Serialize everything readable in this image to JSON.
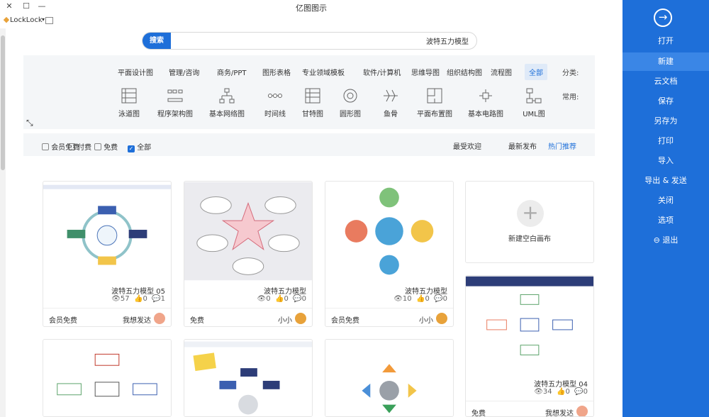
{
  "window": {
    "title": "亿图图示",
    "close": "✕",
    "maximize": "☐",
    "minimize": "—"
  },
  "toolbar": {
    "app_label": "LockLock",
    "flag": "▾"
  },
  "sidebar": {
    "items": [
      {
        "label": "打开"
      },
      {
        "label": "新建"
      },
      {
        "label": "云文档"
      },
      {
        "label": "保存"
      },
      {
        "label": "另存为"
      },
      {
        "label": "打印"
      },
      {
        "label": "导入"
      },
      {
        "label": "导出 & 发送"
      },
      {
        "label": "关闭"
      },
      {
        "label": "选项"
      },
      {
        "label": "退出"
      }
    ]
  },
  "search": {
    "button": "搜索",
    "value": "波特五力模型"
  },
  "categories": {
    "label": "分类:",
    "items": [
      "全部",
      "流程图",
      "组织结构图",
      "思维导图",
      "软件/计算机",
      "专业领域模板",
      "图形表格",
      "商务/PPT",
      "管理/咨询",
      "平面设计图"
    ]
  },
  "tools": {
    "label": "常用:",
    "items": [
      {
        "name": "UML图",
        "icon": "uml-icon"
      },
      {
        "name": "基本电路图",
        "icon": "circuit-icon"
      },
      {
        "name": "平面布置图",
        "icon": "floorplan-icon"
      },
      {
        "name": "鱼骨",
        "icon": "fishbone-icon"
      },
      {
        "name": "圆形图",
        "icon": "circle-diagram-icon"
      },
      {
        "name": "甘特图",
        "icon": "gantt-icon"
      },
      {
        "name": "时间线",
        "icon": "timeline-icon"
      },
      {
        "name": "基本网络图",
        "icon": "network-icon"
      },
      {
        "name": "程序架构图",
        "icon": "program-arch-icon"
      },
      {
        "name": "泳道图",
        "icon": "swimlane-icon"
      }
    ]
  },
  "sort": {
    "hot": "热门推荐",
    "new": "最新发布",
    "popular": "最受欢迎"
  },
  "filters": {
    "all": "全部",
    "free": "免费",
    "paid": "付费",
    "member": "会员免费"
  },
  "new_card": {
    "label": "新建空白画布"
  },
  "cards": [
    {
      "title": "波特五力模型",
      "author": "小小",
      "price": "会员免费",
      "views": "10",
      "likes": "0",
      "comments": "0"
    },
    {
      "title": "波特五力模型",
      "author": "小小",
      "price": "免费",
      "views": "0",
      "likes": "0",
      "comments": "0"
    },
    {
      "title": "波特五力模型 05",
      "author": "我想发达",
      "price": "会员免费",
      "views": "57",
      "likes": "0",
      "comments": "1"
    },
    {
      "title": "波特五力模型 04",
      "author": "我想发达",
      "price": "免费",
      "views": "34",
      "likes": "0",
      "comments": "0"
    }
  ],
  "colors": {
    "accent": "#1e6fd9",
    "panel": "#f4f6f8"
  }
}
